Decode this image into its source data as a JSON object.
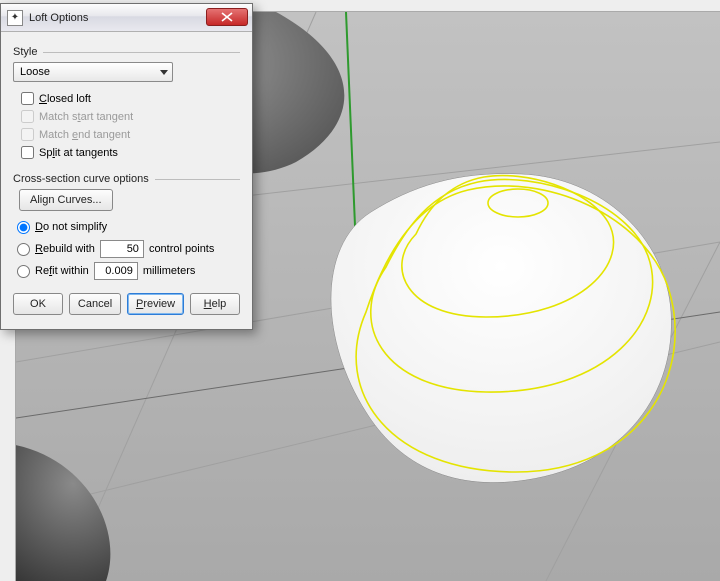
{
  "dialog": {
    "title": "Loft Options",
    "style_label": "Style",
    "style_value": "Loose",
    "checks": {
      "closed_loft": {
        "pre": "",
        "u": "C",
        "post": "losed loft",
        "disabled": false
      },
      "match_start": {
        "pre": "Match s",
        "u": "t",
        "post": "art tangent",
        "disabled": true
      },
      "match_end": {
        "pre": "Match ",
        "u": "e",
        "post": "nd tangent",
        "disabled": true
      },
      "split": {
        "pre": "Sp",
        "u": "l",
        "post": "it at tangents",
        "disabled": false
      }
    },
    "cross_section_label": "Cross-section curve options",
    "align_curves_btn": "Align Curves...",
    "simplify": {
      "do_not": {
        "pre": "",
        "u": "D",
        "post": "o not simplify"
      },
      "rebuild": {
        "pre": "",
        "u": "R",
        "post": "ebuild with",
        "value": "50",
        "unit": "control points"
      },
      "refit": {
        "pre": "Re",
        "u": "f",
        "post": "it within",
        "value": "0.009",
        "unit": "millimeters"
      }
    },
    "buttons": {
      "ok": "OK",
      "cancel": "Cancel",
      "preview_pre": "",
      "preview_u": "P",
      "preview_post": "review",
      "help_pre": "",
      "help_u": "H",
      "help_post": "elp"
    }
  }
}
